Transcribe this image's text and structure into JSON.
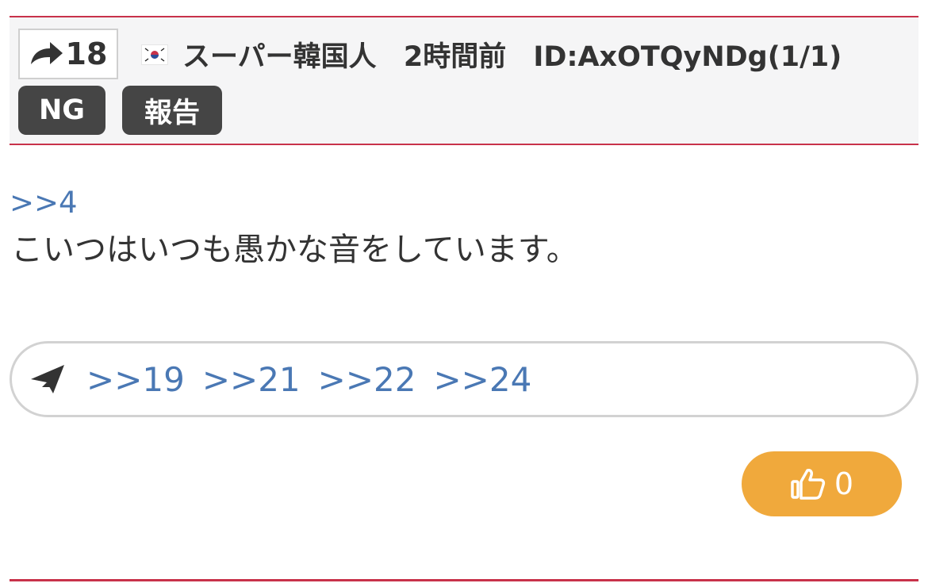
{
  "header": {
    "res_count": "18",
    "flag_country": "KR",
    "name": "スーパー韓国人",
    "time": "2時間前",
    "id": "ID:AxOTQyNDg(1/1)",
    "ng_label": "NG",
    "report_label": "報告"
  },
  "post": {
    "anchor": ">>4",
    "body": "こいつはいつも愚かな音をしています。"
  },
  "replies": {
    "icon": "paper-plane-icon",
    "links": [
      ">>19",
      ">>21",
      ">>22",
      ">>24"
    ]
  },
  "like": {
    "icon": "thumbs-up-icon",
    "count": "0"
  },
  "colors": {
    "accent_red": "#c8324a",
    "link_blue": "#4a78b4",
    "like_orange": "#f0a93c",
    "dark_button": "#454545"
  }
}
